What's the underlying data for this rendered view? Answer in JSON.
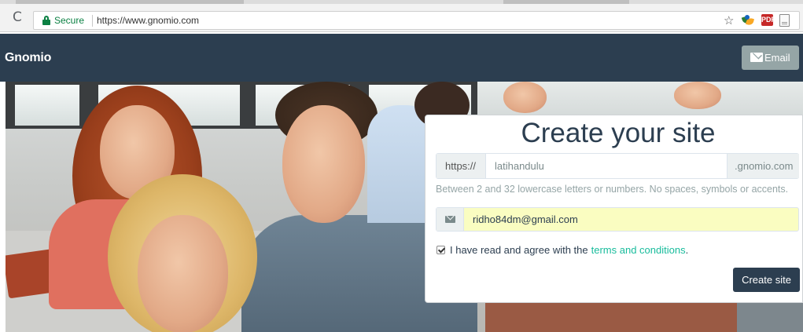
{
  "browser": {
    "reload_icon": "reload-icon",
    "security_label": "Secure",
    "url": "https://www.gnomio.com",
    "bookmark_icon": "star-icon"
  },
  "navbar": {
    "brand": "Gnomio",
    "email_button": "Email",
    "background_color": "#2c3e50"
  },
  "form": {
    "title": "Create your site",
    "url_prefix": "https://",
    "subdomain_value": "latihandulu",
    "url_suffix": ".gnomio.com",
    "help_text": "Between 2 and 32 lowercase letters or numbers. No spaces, symbols or accents.",
    "email_value": "ridho84dm@gmail.com",
    "terms_checked": true,
    "terms_text": "I have read and agree with the",
    "terms_link": "terms and conditions",
    "terms_suffix": ".",
    "submit_label": "Create site",
    "accent_color": "#18bc9c"
  }
}
